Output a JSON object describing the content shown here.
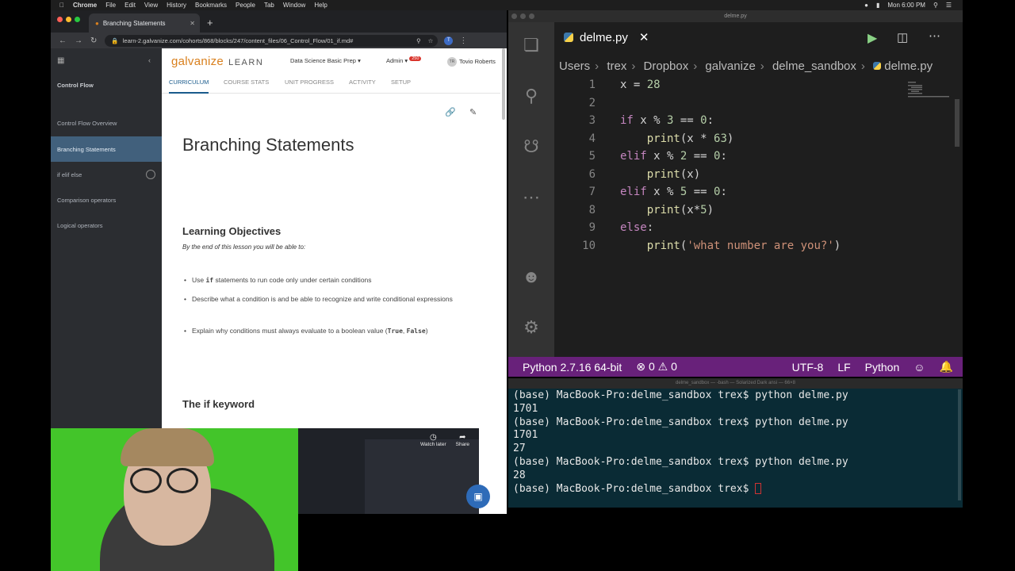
{
  "menubar": {
    "app": "Chrome",
    "items": [
      "File",
      "Edit",
      "View",
      "History",
      "Bookmarks",
      "People",
      "Tab",
      "Window",
      "Help"
    ],
    "clock": "Mon 6:00 PM"
  },
  "chrome": {
    "tab_title": "Branching Statements",
    "url": "learn-2.galvanize.com/cohorts/868/blocks/247/content_files/06_Control_Flow/01_if.md#",
    "profile_initial": "T"
  },
  "sidebar": {
    "section": "Control Flow",
    "items": [
      {
        "label": "Control Flow Overview"
      },
      {
        "label": "Branching Statements"
      },
      {
        "label": "if elif else"
      },
      {
        "label": "Comparison operators"
      },
      {
        "label": "Logical operators"
      }
    ]
  },
  "learn_header": {
    "logo": "galvanize",
    "logo_suffix": "LEARN",
    "course": "Data Science Basic Prep",
    "admin": "Admin",
    "badge": "250",
    "user_initials": "TR",
    "user": "Tovio Roberts",
    "tabs": [
      "CURRICULUM",
      "COURSE STATS",
      "UNIT PROGRESS",
      "ACTIVITY",
      "SETUP"
    ]
  },
  "article": {
    "title": "Branching Statements",
    "objectives_heading": "Learning Objectives",
    "lead": "By the end of this lesson you will be able to:",
    "b1_pre": "Use ",
    "b1_code": "if",
    "b1_post": " statements to run code only under certain conditions",
    "b2": "Describe what a condition is and be able to recognize and write conditional expressions",
    "b3_pre": "Explain why conditions must always evaluate to a boolean value (",
    "b3_true": "True",
    "b3_sep": ", ",
    "b3_false": "False",
    "b3_post": ")",
    "if_heading": "The if keyword",
    "video_watch_later": "Watch later",
    "video_share": "Share"
  },
  "vscode": {
    "window_title": "delme.py",
    "tab_label": "delme.py",
    "breadcrumb": [
      "Users",
      "trex",
      "Dropbox",
      "galvanize",
      "delme_sandbox",
      "delme.py"
    ],
    "line_numbers": [
      "1",
      "2",
      "3",
      "4",
      "5",
      "6",
      "7",
      "8",
      "9",
      "10"
    ],
    "status": {
      "interpreter": "Python 2.7.16 64-bit",
      "errors": "0",
      "warnings": "0",
      "encoding": "UTF-8",
      "eol": "LF",
      "language": "Python"
    }
  },
  "terminal": {
    "title": "delme_sandbox — -bash — Solarized Dark ansi — 66×8",
    "lines": [
      "(base) MacBook-Pro:delme_sandbox trex$ python delme.py",
      "1701",
      "(base) MacBook-Pro:delme_sandbox trex$ python delme.py",
      "1701",
      "27",
      "(base) MacBook-Pro:delme_sandbox trex$ python delme.py",
      "28"
    ],
    "prompt": "(base) MacBook-Pro:delme_sandbox trex$ "
  }
}
